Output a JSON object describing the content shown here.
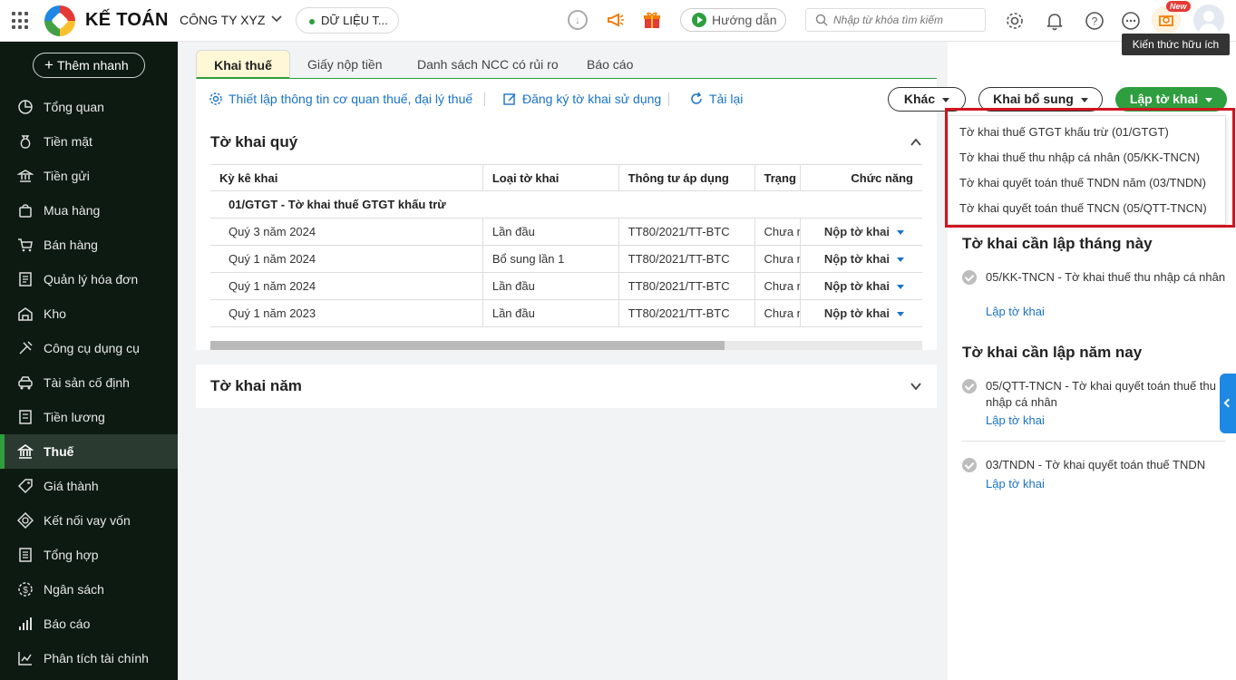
{
  "app": {
    "logo": "KẾ TOÁN",
    "company": "CÔNG TY XYZ",
    "data_label": "DỮ LIỆU T...",
    "guide": "Hướng dẫn",
    "new_badge": "New",
    "tooltip": "Kiến thức hữu ích"
  },
  "search": {
    "placeholder": "Nhập từ khóa tìm kiếm"
  },
  "sidebar": {
    "add_button": "Thêm nhanh",
    "items": [
      {
        "label": "Tổng quan",
        "icon": "chart-pie-icon"
      },
      {
        "label": "Tiền mặt",
        "icon": "money-bag-icon"
      },
      {
        "label": "Tiền gửi",
        "icon": "bank-icon"
      },
      {
        "label": "Mua hàng",
        "icon": "shopping-bag-icon"
      },
      {
        "label": "Bán hàng",
        "icon": "cart-icon"
      },
      {
        "label": "Quản lý hóa đơn",
        "icon": "invoice-icon"
      },
      {
        "label": "Kho",
        "icon": "warehouse-icon"
      },
      {
        "label": "Công cụ dụng cụ",
        "icon": "tools-icon"
      },
      {
        "label": "Tài sản cố định",
        "icon": "car-icon"
      },
      {
        "label": "Tiền lương",
        "icon": "payroll-icon"
      },
      {
        "label": "Thuế",
        "icon": "tax-building-icon"
      },
      {
        "label": "Giá thành",
        "icon": "price-tag-icon"
      },
      {
        "label": "Kết nối vay vốn",
        "icon": "loan-icon"
      },
      {
        "label": "Tổng hợp",
        "icon": "summary-icon"
      },
      {
        "label": "Ngân sách",
        "icon": "budget-icon"
      },
      {
        "label": "Báo cáo",
        "icon": "report-bars-icon"
      },
      {
        "label": "Phân tích tài chính",
        "icon": "analytics-icon"
      }
    ],
    "active_index": 10
  },
  "tabs": [
    "Khai thuế",
    "Giấy nộp tiền",
    "Danh sách NCC có rủi ro",
    "Báo cáo"
  ],
  "toolbar": {
    "setup": "Thiết lập thông tin cơ quan thuế, đại lý thuế",
    "register": "Đăng ký tờ khai sử dụng",
    "reload": "Tải lại"
  },
  "quarter": {
    "title": "Tờ khai quý",
    "columns": [
      "Kỳ kê khai",
      "Loại tờ khai",
      "Thông tư áp dụng",
      "Trạng",
      "Chức năng"
    ],
    "group": "01/GTGT - Tờ khai thuế GTGT khấu trừ",
    "rows": [
      {
        "period": "Quý 3 năm 2024",
        "type": "Lần đầu",
        "circular": "TT80/2021/TT-BTC",
        "status": "Chưa nộp",
        "action": "Nộp tờ khai"
      },
      {
        "period": "Quý 1 năm 2024",
        "type": "Bổ sung lần 1",
        "circular": "TT80/2021/TT-BTC",
        "status": "Chưa nộp",
        "action": "Nộp tờ khai"
      },
      {
        "period": "Quý 1 năm 2024",
        "type": "Lần đầu",
        "circular": "TT80/2021/TT-BTC",
        "status": "Chưa nộp",
        "action": "Nộp tờ khai"
      },
      {
        "period": "Quý 1 năm 2023",
        "type": "Lần đầu",
        "circular": "TT80/2021/TT-BTC",
        "status": "Chưa nộp",
        "action": "Nộp tờ khai"
      }
    ]
  },
  "year": {
    "title": "Tờ khai năm"
  },
  "right": {
    "buttons": {
      "other": "Khác",
      "supplement": "Khai bổ sung",
      "create": "Lập tờ khai"
    },
    "dropdown": [
      "Tờ khai thuế GTGT khấu trừ (01/GTGT)",
      "Tờ khai thuế thu nhập cá nhân (05/KK-TNCN)",
      "Tờ khai quyết toán thuế TNDN năm (03/TNDN)",
      "Tờ khai quyết toán thuế TNCN (05/QTT-TNCN)"
    ],
    "month_title": "Tờ khai cần lập tháng này",
    "month_items": [
      {
        "text": "05/KK-TNCN - Tờ khai thuế thu nhập cá nhân",
        "link": "Lập tờ khai"
      }
    ],
    "year_title": "Tờ khai cần lập năm nay",
    "year_items": [
      {
        "text": "05/QTT-TNCN - Tờ khai quyết toán thuế thu nhập cá nhân",
        "link": "Lập tờ khai"
      },
      {
        "text": "03/TNDN - Tờ khai quyết toán thuế TNDN",
        "link": "Lập tờ khai"
      }
    ]
  },
  "colors": {
    "brand_green": "#2e9e3e",
    "link_blue": "#1a73c7",
    "sidebar_bg": "#0c1a12",
    "highlight_red": "#d1141e"
  }
}
